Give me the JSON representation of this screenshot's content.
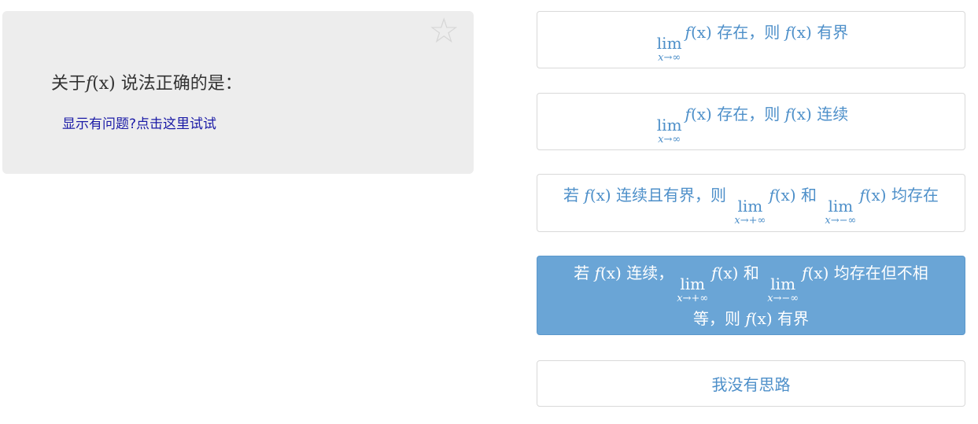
{
  "question": {
    "prefix": "关于",
    "func": "f",
    "arg": "(x)",
    "suffix": " 说法正确的是：",
    "help_link": "显示有问题?点击这里试试"
  },
  "options": [
    {
      "lim_word": "lim",
      "lim_sub": "x→∞",
      "func": "f",
      "arg": "(x)",
      "mid": " 存在，则 ",
      "func2": "f",
      "arg2": "(x)",
      "tail": " 有界"
    },
    {
      "lim_word": "lim",
      "lim_sub": "x→∞",
      "func": "f",
      "arg": "(x)",
      "mid": " 存在，则 ",
      "func2": "f",
      "arg2": "(x)",
      "tail": " 连续"
    },
    {
      "lead": "若 ",
      "func": "f",
      "arg": "(x)",
      "mid": " 连续且有界，则 ",
      "lim1_word": "lim",
      "lim1_sub": "x→+∞",
      "func2": "f",
      "arg2": "(x)",
      "and": " 和 ",
      "lim2_word": "lim",
      "lim2_sub": "x→−∞",
      "func3": "f",
      "arg3": "(x)",
      "tail": " 均存在"
    },
    {
      "lead": "若 ",
      "func": "f",
      "arg": "(x)",
      "mid": " 连续，",
      "lim1_word": "lim",
      "lim1_sub": "x→+∞",
      "func2": "f",
      "arg2": "(x)",
      "and": " 和 ",
      "lim2_word": "lim",
      "lim2_sub": "x→−∞",
      "func3": "f",
      "arg3": "(x)",
      "tail": " 均存在但不相",
      "line2_lead": "等，则 ",
      "func4": "f",
      "arg4": "(x)",
      "line2_tail": " 有界"
    },
    {
      "label": "我没有思路"
    }
  ],
  "selected_option": 4,
  "colors": {
    "accent": "#4d8fc9",
    "selected_bg": "#6aa5d6",
    "card_bg": "#ededed",
    "link": "#1a1aa6"
  },
  "icons": {
    "favorite": "star-outline-icon"
  }
}
